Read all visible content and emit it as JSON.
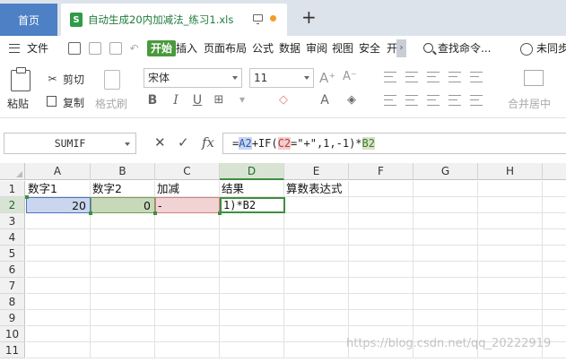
{
  "tabs": {
    "home": "首页",
    "file_icon": "S",
    "file_name": "自动生成20内加减法_练习1.xls",
    "new_tab": "+"
  },
  "menu": {
    "file": "文件",
    "start": "开始",
    "insert": "插入",
    "page_layout": "页面布局",
    "formula": "公式",
    "data": "数据",
    "review": "审阅",
    "view": "视图",
    "security": "安全",
    "overflow_char": "开",
    "search": "查找命令...",
    "cloud": "未同步"
  },
  "ribbon": {
    "paste": "粘贴",
    "cut": "剪切",
    "copy": "复制",
    "format_painter": "格式刷",
    "font_name": "宋体",
    "font_size": "11",
    "bold": "B",
    "italic": "I",
    "underline": "U",
    "merge_center": "合并居中"
  },
  "formula_bar": {
    "name_box": "SUMIF",
    "cancel": "✕",
    "confirm": "✓",
    "fx": "fx",
    "parts": {
      "p1": "=",
      "p2": "A2",
      "p3": "+IF(",
      "p4": "C2",
      "p5": "=\"+\",1,-1)*",
      "p6": "B2"
    }
  },
  "grid": {
    "columns": [
      "A",
      "B",
      "C",
      "D",
      "E",
      "F",
      "G",
      "H"
    ],
    "rows": [
      "1",
      "2",
      "3",
      "4",
      "5",
      "6",
      "7",
      "8",
      "9",
      "10",
      "11"
    ],
    "row1": {
      "A": "数字1",
      "B": "数字2",
      "C": "加减",
      "D": "结果",
      "E": "算数表达式"
    },
    "row2": {
      "A": "20",
      "B": "0",
      "C": "-",
      "D": "1)*B2"
    }
  },
  "watermark": "https://blog.csdn.net/qq_20222919"
}
